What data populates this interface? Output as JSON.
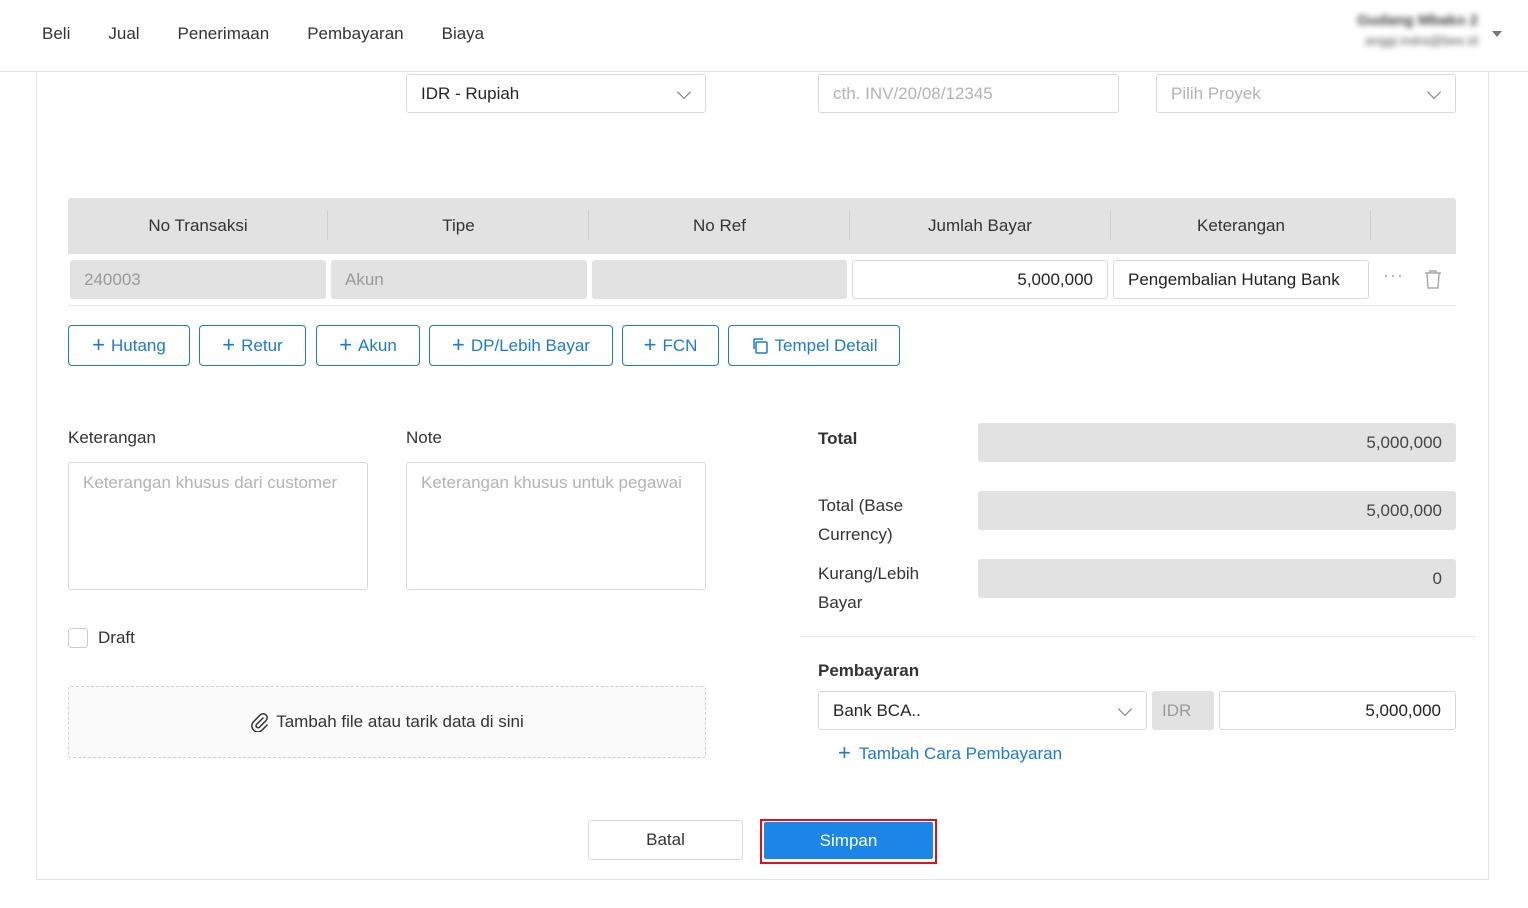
{
  "nav": {
    "items": [
      "Beli",
      "Jual",
      "Penerimaan",
      "Pembayaran",
      "Biaya"
    ],
    "user_name": "Gudang Mbako 2",
    "user_email": "anggi.indra@bee.id"
  },
  "form": {
    "currency": "IDR - Rupiah",
    "invoice_placeholder": "cth. INV/20/08/12345",
    "project_placeholder": "Pilih Proyek"
  },
  "table": {
    "headers": [
      "No Transaksi",
      "Tipe",
      "No Ref",
      "Jumlah Bayar",
      "Keterangan"
    ],
    "row": {
      "no_transaksi": "240003",
      "tipe_placeholder": "Akun",
      "no_ref": "",
      "jumlah_bayar": "5,000,000",
      "keterangan": "Pengembalian Hutang Bank",
      "more": "···"
    }
  },
  "add_buttons": {
    "hutang": "Hutang",
    "retur": "Retur",
    "akun": "Akun",
    "dp": "DP/Lebih Bayar",
    "fcn": "FCN",
    "tempel": "Tempel Detail"
  },
  "notes": {
    "keterangan_label": "Keterangan",
    "keterangan_placeholder": "Keterangan khusus dari customer",
    "note_label": "Note",
    "note_placeholder": "Keterangan khusus untuk pegawai",
    "draft_label": "Draft",
    "dropzone_text": "Tambah file atau tarik data di sini"
  },
  "summary": {
    "total_label": "Total",
    "total_value": "5,000,000",
    "total_base_label_1": "Total (Base",
    "total_base_label_2": "Currency)",
    "total_base_value": "5,000,000",
    "kurang_label_1": "Kurang/Lebih",
    "kurang_label_2": "Bayar",
    "kurang_value": "0"
  },
  "payment": {
    "label": "Pembayaran",
    "method": "Bank BCA..",
    "currency": "IDR",
    "amount": "5,000,000",
    "add_link": "Tambah Cara Pembayaran"
  },
  "actions": {
    "cancel": "Batal",
    "save": "Simpan"
  },
  "colors": {
    "accent": "#1c7ad6",
    "save_bg": "#1c85e8",
    "highlight": "#e0101e"
  }
}
